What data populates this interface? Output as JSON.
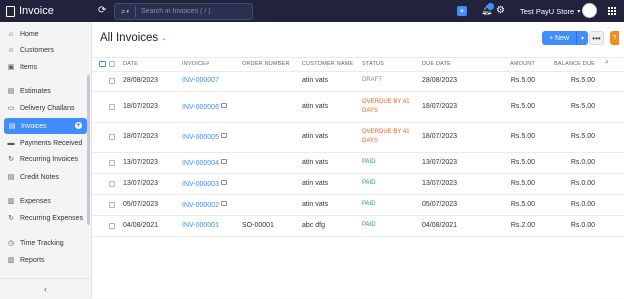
{
  "app": {
    "name": "Invoice"
  },
  "search": {
    "placeholder": "Search in Invoices ( / )"
  },
  "header": {
    "org_name": "Test PayU Store"
  },
  "sidebar": {
    "items": [
      {
        "label": "Home",
        "icon": "home-icon"
      },
      {
        "label": "Customers",
        "icon": "person-icon"
      },
      {
        "label": "Items",
        "icon": "box-icon"
      },
      {
        "label": "Estimates",
        "icon": "document-icon"
      },
      {
        "label": "Delivery Challans",
        "icon": "truck-icon"
      },
      {
        "label": "Invoices",
        "icon": "invoice-icon"
      },
      {
        "label": "Payments Received",
        "icon": "card-icon"
      },
      {
        "label": "Recurring Invoices",
        "icon": "recurring-icon"
      },
      {
        "label": "Credit Notes",
        "icon": "credit-note-icon"
      },
      {
        "label": "Expenses",
        "icon": "wallet-icon"
      },
      {
        "label": "Recurring Expenses",
        "icon": "recurring-icon"
      },
      {
        "label": "Time Tracking",
        "icon": "clock-icon"
      },
      {
        "label": "Reports",
        "icon": "chart-icon"
      }
    ],
    "active": "Invoices",
    "collapse_glyph": "‹"
  },
  "main": {
    "title": "All Invoices",
    "new_label": "+ New",
    "more_label": "•••",
    "help_label": "?"
  },
  "table": {
    "headers": {
      "date": "DATE",
      "invoice": "INVOICE#",
      "order": "ORDER NUMBER",
      "customer": "CUSTOMER NAME",
      "status": "STATUS",
      "due": "DUE DATE",
      "amount": "AMOUNT",
      "balance": "BALANCE DUE"
    },
    "rows": [
      {
        "date": "28/08/2023",
        "invoice": "INV-000007",
        "mail": false,
        "order": "",
        "customer": "atin vats",
        "status": "DRAFT",
        "status_type": "draft",
        "due": "28/08/2023",
        "amount": "Rs.5.00",
        "balance": "Rs.5.00"
      },
      {
        "date": "18/07/2023",
        "invoice": "INV-000006",
        "mail": true,
        "order": "",
        "customer": "atin vats",
        "status": "OVERDUE BY 41 DAYS",
        "status_type": "overdue",
        "due": "18/07/2023",
        "amount": "Rs.5.00",
        "balance": "Rs.5.00"
      },
      {
        "date": "18/07/2023",
        "invoice": "INV-000005",
        "mail": true,
        "order": "",
        "customer": "atin vats",
        "status": "OVERDUE BY 41 DAYS",
        "status_type": "overdue",
        "due": "18/07/2023",
        "amount": "Rs.5.00",
        "balance": "Rs.5.00"
      },
      {
        "date": "13/07/2023",
        "invoice": "INV-000004",
        "mail": true,
        "order": "",
        "customer": "atin vats",
        "status": "PAID",
        "status_type": "paid",
        "due": "13/07/2023",
        "amount": "Rs.5.00",
        "balance": "Rs.0.00"
      },
      {
        "date": "13/07/2023",
        "invoice": "INV-000003",
        "mail": true,
        "order": "",
        "customer": "atin vats",
        "status": "PAID",
        "status_type": "paid",
        "due": "13/07/2023",
        "amount": "Rs.5.00",
        "balance": "Rs.0.00"
      },
      {
        "date": "05/07/2023",
        "invoice": "INV-000002",
        "mail": true,
        "order": "",
        "customer": "atin vats",
        "status": "PAID",
        "status_type": "paid",
        "due": "05/07/2023",
        "amount": "Rs.5.00",
        "balance": "Rs.0.00"
      },
      {
        "date": "04/08/2021",
        "invoice": "INV-000001",
        "mail": false,
        "order": "SO-00001",
        "customer": "abc dfg",
        "status": "PAID",
        "status_type": "paid",
        "due": "04/08/2021",
        "amount": "Rs.2.00",
        "balance": "Rs.0.00"
      }
    ]
  },
  "colors": {
    "accent": "#408dfb",
    "topbar": "#20233b",
    "overdue": "#f2621d",
    "paid": "#1fa35a",
    "help": "#f28c1d"
  }
}
